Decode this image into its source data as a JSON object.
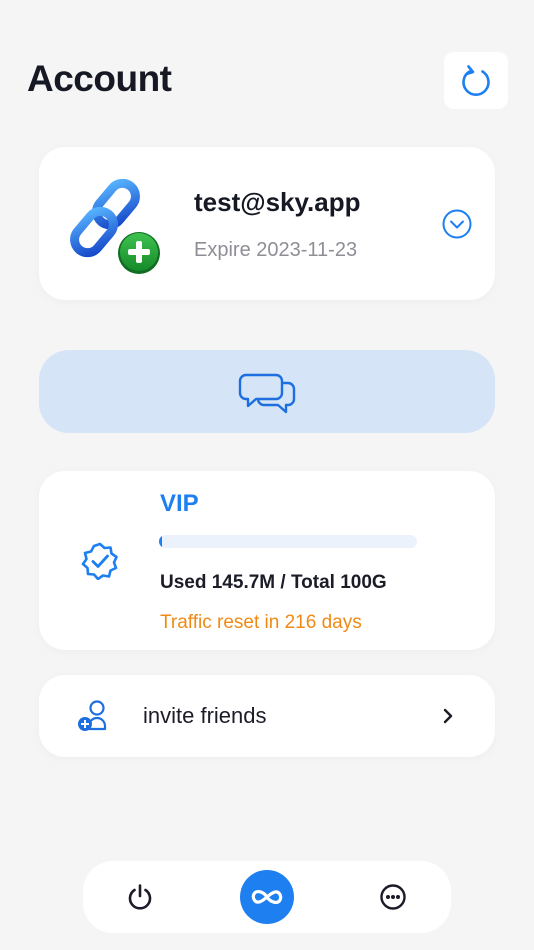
{
  "header": {
    "title": "Account",
    "refresh_icon": "refresh-icon"
  },
  "account": {
    "email": "test@sky.app",
    "expire": "Expire 2023-11-23",
    "logo_icon": "chain-link-add-icon",
    "dropdown_icon": "chevron-down-circle-icon"
  },
  "support": {
    "icon": "chat-bubbles-icon"
  },
  "plan": {
    "name": "VIP",
    "badge_icon": "verified-badge-icon",
    "usage": "Used 145.7M / Total 100G",
    "usage_fraction": 0.0015,
    "reset": "Traffic reset in 216 days"
  },
  "invite": {
    "label": "invite friends",
    "icon": "add-user-icon",
    "chevron_icon": "chevron-right-icon"
  },
  "tabbar": {
    "tabs": [
      {
        "icon": "power-icon",
        "active": false
      },
      {
        "icon": "infinity-icon",
        "active": true
      },
      {
        "icon": "more-dots-icon",
        "active": false
      }
    ]
  },
  "colors": {
    "accent": "#1d7ff0",
    "warning": "#f08a14",
    "banner_bg": "#d5e4f6",
    "background": "#f5f5f6"
  }
}
